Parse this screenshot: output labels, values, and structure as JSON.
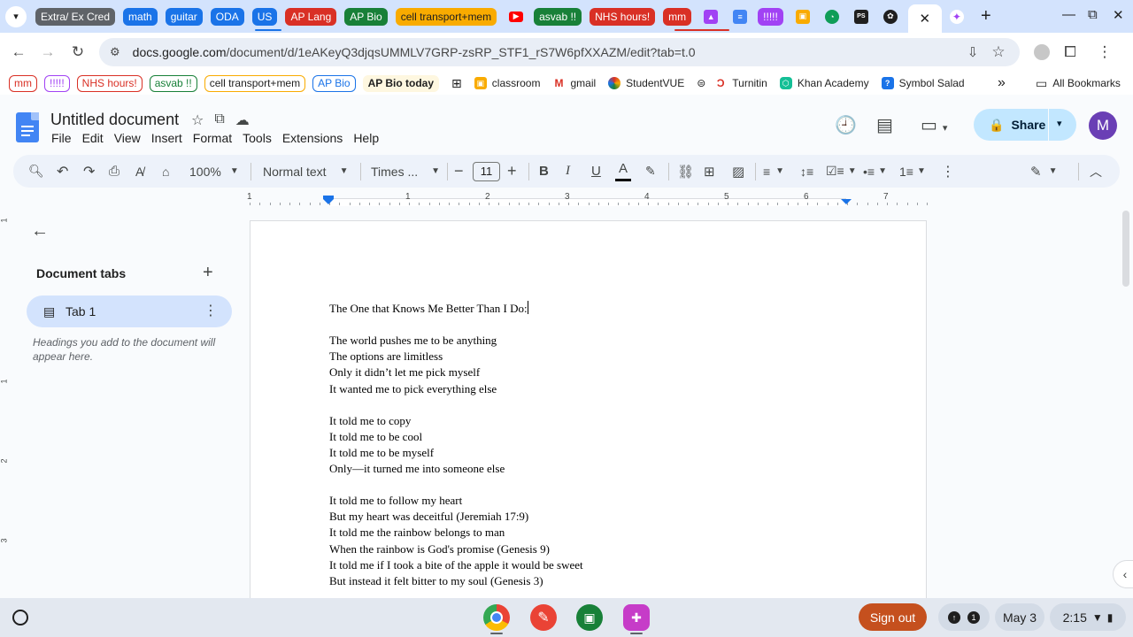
{
  "tabstrip": {
    "groups": [
      {
        "label": "Extra/ Ex Cred",
        "color": "#5f6368"
      },
      {
        "label": "math",
        "color": "#1a73e8"
      },
      {
        "label": "guitar",
        "color": "#1a73e8"
      },
      {
        "label": "ODA",
        "color": "#1a73e8"
      },
      {
        "label": "US",
        "color": "#1a73e8"
      },
      {
        "label": "AP Lang",
        "color": "#d93025"
      },
      {
        "label": "AP Bio",
        "color": "#188038"
      },
      {
        "label": "cell transport+mem",
        "color": "#f9ab00"
      },
      {
        "label": "asvab !!",
        "color": "#188038"
      },
      {
        "label": "NHS hours!",
        "color": "#d93025"
      },
      {
        "label": "mm",
        "color": "#d93025"
      },
      {
        "label": "!!!!!",
        "color": "#a142f4"
      }
    ],
    "close_glyph": "✕",
    "new_tab_glyph": "+"
  },
  "address_bar": {
    "domain": "docs.google.com",
    "path": "/document/d/1eAKeyQ3djqsUMMLV7GRP-zsRP_STF1_rS7W6pfXXAZM/edit?tab=t.0"
  },
  "bookmarks": {
    "chips": [
      {
        "label": "mm",
        "color": "#d93025"
      },
      {
        "label": "!!!!!",
        "color": "#a142f4"
      },
      {
        "label": "NHS hours!",
        "color": "#d93025"
      },
      {
        "label": "asvab !!",
        "color": "#188038"
      },
      {
        "label": "cell transport+mem",
        "color": "#f9ab00"
      },
      {
        "label": "AP Bio",
        "color": "#1a73e8"
      }
    ],
    "ap_bio_today": "AP Bio today",
    "links": [
      "classroom",
      "gmail",
      "StudentVUE",
      "Turnitin",
      "Khan Academy",
      "Symbol Salad"
    ],
    "overflow": "»",
    "all_bookmarks": "All Bookmarks"
  },
  "docs": {
    "title": "Untitled document",
    "menu": [
      "File",
      "Edit",
      "View",
      "Insert",
      "Format",
      "Tools",
      "Extensions",
      "Help"
    ],
    "share_label": "Share",
    "avatar_letter": "M"
  },
  "format_toolbar": {
    "zoom": "100%",
    "style": "Normal text",
    "font": "Times ...",
    "font_size": "11",
    "bold": "B",
    "italic": "I",
    "underline": "U",
    "text_color": "A"
  },
  "ruler": {
    "numbers": [
      "1",
      "1",
      "2",
      "3",
      "4",
      "5",
      "6",
      "7"
    ]
  },
  "vruler": {
    "numbers": [
      "1",
      "1",
      "2",
      "3"
    ]
  },
  "sidebar": {
    "heading": "Document tabs",
    "tab_label": "Tab 1",
    "hint": "Headings you add to the document will appear here."
  },
  "document": {
    "title_line": "The One that Knows Me Better Than I Do:",
    "stanzas": [
      [
        "The world pushes me to be anything",
        "The options are limitless",
        "Only it didn’t let me pick myself",
        "It wanted me to pick everything else"
      ],
      [
        "It told me to copy",
        "It told me to be cool",
        "It told me to be myself",
        "Only—it turned me into someone else"
      ],
      [
        "It told me to follow my heart",
        "But my heart was deceitful (Jeremiah 17:9)",
        "It told me the rainbow belongs to man",
        "When the rainbow is God's promise (Genesis 9)",
        "It told me if I took a bite of the apple it would be sweet",
        "But instead it felt bitter to my soul (Genesis 3)"
      ]
    ]
  },
  "shelf": {
    "sign_out": "Sign out",
    "notifications": "1",
    "date": "May 3",
    "time": "2:15"
  }
}
